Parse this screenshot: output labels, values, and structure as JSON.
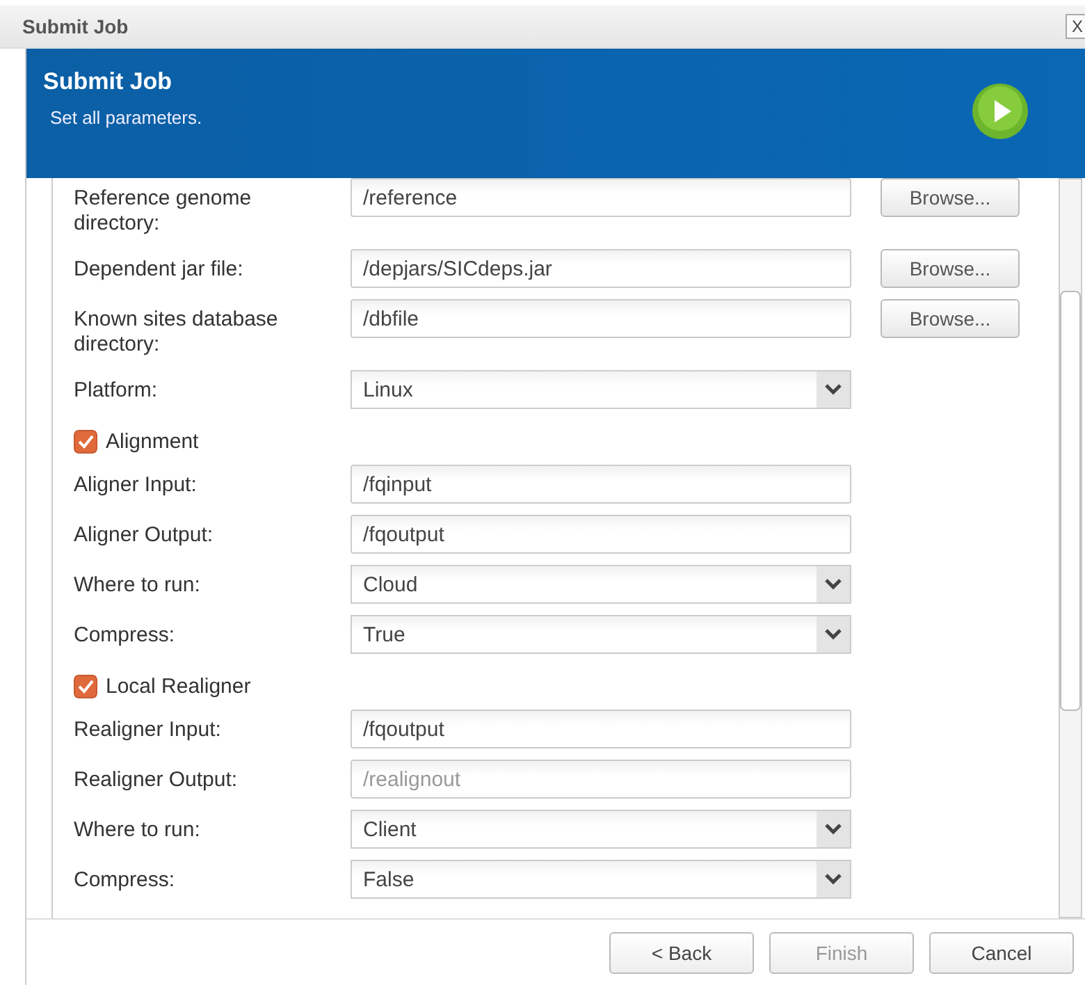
{
  "window": {
    "title": "Submit Job",
    "close": "X"
  },
  "header": {
    "title": "Submit Job",
    "subtitle": "Set all parameters."
  },
  "rows": [
    {
      "kind": "text",
      "label": "Reference genome directory:",
      "value": "/reference",
      "disabled": false,
      "browse": "Browse..."
    },
    {
      "kind": "text",
      "label": "Dependent jar file:",
      "value": "/depjars/SICdeps.jar",
      "disabled": false,
      "browse": "Browse..."
    },
    {
      "kind": "text",
      "label": "Known sites database directory:",
      "value": "/dbfile",
      "disabled": false,
      "browse": "Browse..."
    },
    {
      "kind": "select",
      "label": "Platform:",
      "value": "Linux"
    },
    {
      "kind": "checkbox",
      "label": "Alignment",
      "checked": true
    },
    {
      "kind": "text",
      "label": "Aligner Input:",
      "value": "/fqinput",
      "disabled": false
    },
    {
      "kind": "text",
      "label": "Aligner Output:",
      "value": "/fqoutput",
      "disabled": false
    },
    {
      "kind": "select",
      "label": "Where to run:",
      "value": "Cloud"
    },
    {
      "kind": "select",
      "label": "Compress:",
      "value": "True"
    },
    {
      "kind": "checkbox",
      "label": "Local Realigner",
      "checked": true
    },
    {
      "kind": "text",
      "label": "Realigner Input:",
      "value": "/fqoutput",
      "disabled": false
    },
    {
      "kind": "text",
      "label": "Realigner Output:",
      "value": "/realignout",
      "disabled": true
    },
    {
      "kind": "select",
      "label": "Where to run:",
      "value": "Client"
    },
    {
      "kind": "select",
      "label": "Compress:",
      "value": "False"
    }
  ],
  "buttons": [
    {
      "label": "< Back",
      "disabled": false
    },
    {
      "label": "Finish",
      "disabled": true
    },
    {
      "label": "Cancel",
      "disabled": false
    }
  ]
}
